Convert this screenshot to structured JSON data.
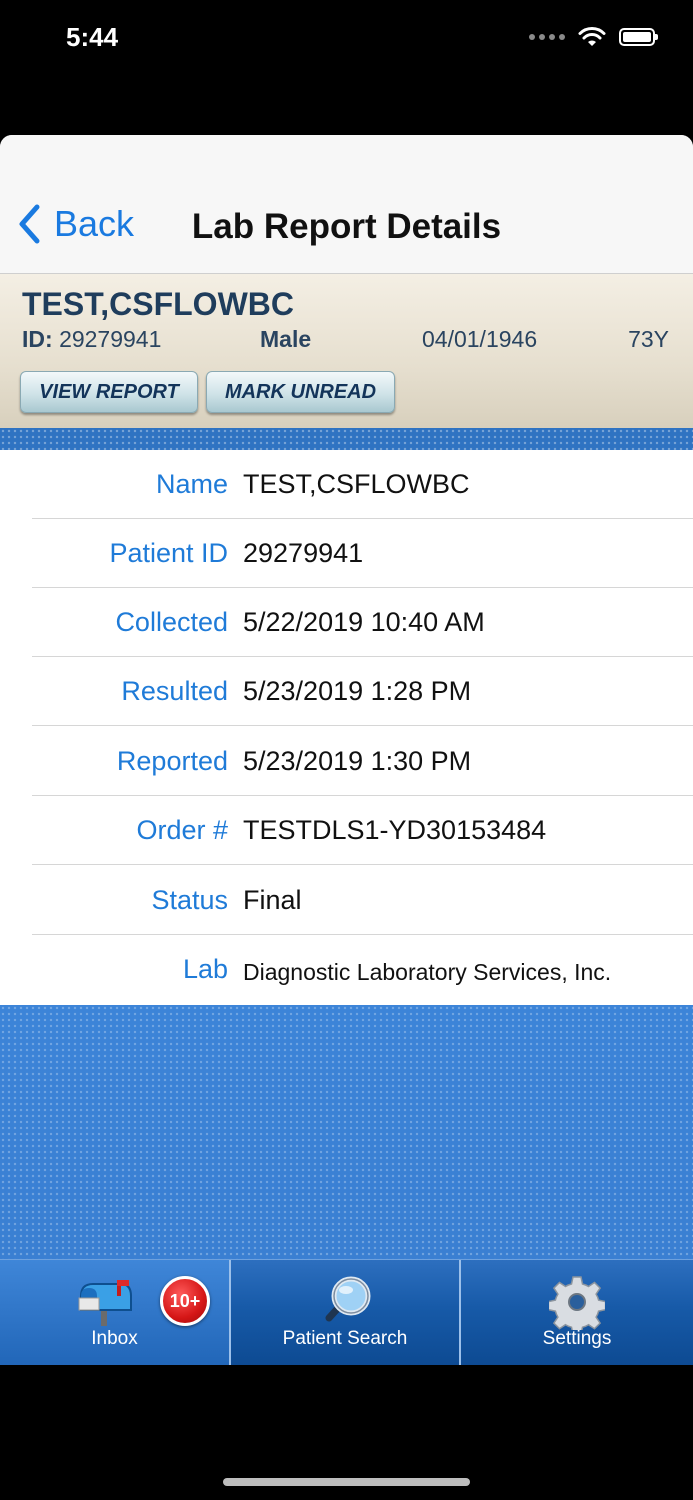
{
  "status_bar": {
    "time": "5:44"
  },
  "nav": {
    "back_label": "Back",
    "title": "Lab Report Details"
  },
  "patient": {
    "name": "TEST,CSFLOWBC",
    "id_label": "ID:",
    "id": "29279941",
    "sex": "Male",
    "dob": "04/01/1946",
    "age": "73Y",
    "view_report": "VIEW REPORT",
    "mark_unread": "MARK UNREAD"
  },
  "details": [
    {
      "label": "Name",
      "value": "TEST,CSFLOWBC"
    },
    {
      "label": "Patient ID",
      "value": "29279941"
    },
    {
      "label": "Collected",
      "value": "5/22/2019 10:40 AM"
    },
    {
      "label": "Resulted",
      "value": "5/23/2019 1:28 PM"
    },
    {
      "label": "Reported",
      "value": "5/23/2019 1:30 PM"
    },
    {
      "label": "Order #",
      "value": "TESTDLS1-YD30153484"
    },
    {
      "label": "Status",
      "value": "Final"
    },
    {
      "label": "Lab",
      "value": "Diagnostic Laboratory Services, Inc."
    }
  ],
  "tabs": {
    "inbox": {
      "label": "Inbox",
      "badge": "10+",
      "icon": "mailbox-icon"
    },
    "patient_search": {
      "label": "Patient Search",
      "icon": "magnifier-icon"
    },
    "settings": {
      "label": "Settings",
      "icon": "gear-icon"
    }
  },
  "colors": {
    "link": "#1a7ae0",
    "label": "#1f7bd8",
    "header": "#1f3d5c",
    "tabbar": "#175aa8",
    "badge": "#d51616"
  }
}
